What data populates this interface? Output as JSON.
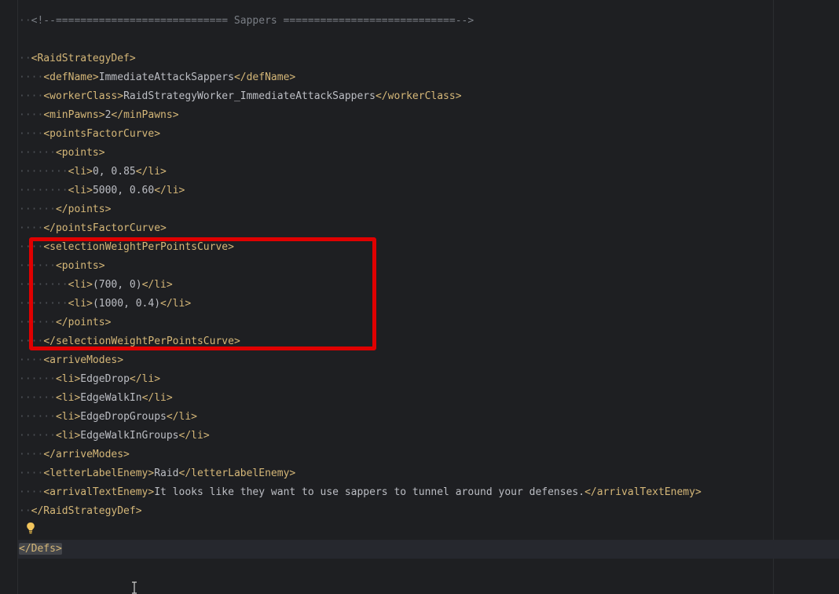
{
  "editor": {
    "lines": [
      {
        "indent": 1,
        "segments": [
          {
            "t": "c",
            "v": "<!--============================ Sappers ============================-->"
          }
        ]
      },
      {
        "indent": 0,
        "segments": []
      },
      {
        "indent": 1,
        "segments": [
          {
            "t": "g",
            "v": "<RaidStrategyDef>"
          }
        ]
      },
      {
        "indent": 2,
        "segments": [
          {
            "t": "g",
            "v": "<defName>"
          },
          {
            "t": "x",
            "v": "ImmediateAttackSappers"
          },
          {
            "t": "g",
            "v": "</defName>"
          }
        ]
      },
      {
        "indent": 2,
        "segments": [
          {
            "t": "g",
            "v": "<workerClass>"
          },
          {
            "t": "x",
            "v": "RaidStrategyWorker_ImmediateAttackSappers"
          },
          {
            "t": "g",
            "v": "</workerClass>"
          }
        ]
      },
      {
        "indent": 2,
        "segments": [
          {
            "t": "g",
            "v": "<minPawns>"
          },
          {
            "t": "x",
            "v": "2"
          },
          {
            "t": "g",
            "v": "</minPawns>"
          }
        ]
      },
      {
        "indent": 2,
        "segments": [
          {
            "t": "g",
            "v": "<pointsFactorCurve>"
          }
        ]
      },
      {
        "indent": 3,
        "segments": [
          {
            "t": "g",
            "v": "<points>"
          }
        ]
      },
      {
        "indent": 4,
        "segments": [
          {
            "t": "g",
            "v": "<li>"
          },
          {
            "t": "x",
            "v": "0, 0.85"
          },
          {
            "t": "g",
            "v": "</li>"
          }
        ]
      },
      {
        "indent": 4,
        "segments": [
          {
            "t": "g",
            "v": "<li>"
          },
          {
            "t": "x",
            "v": "5000, 0.60"
          },
          {
            "t": "g",
            "v": "</li>"
          }
        ]
      },
      {
        "indent": 3,
        "segments": [
          {
            "t": "g",
            "v": "</points>"
          }
        ]
      },
      {
        "indent": 2,
        "segments": [
          {
            "t": "g",
            "v": "</pointsFactorCurve>"
          }
        ]
      },
      {
        "indent": 2,
        "segments": [
          {
            "t": "g",
            "v": "<selectionWeightPerPointsCurve>"
          }
        ]
      },
      {
        "indent": 3,
        "segments": [
          {
            "t": "g",
            "v": "<points>"
          }
        ]
      },
      {
        "indent": 4,
        "segments": [
          {
            "t": "g",
            "v": "<li>"
          },
          {
            "t": "x",
            "v": "(700, 0)"
          },
          {
            "t": "g",
            "v": "</li>"
          }
        ]
      },
      {
        "indent": 4,
        "segments": [
          {
            "t": "g",
            "v": "<li>"
          },
          {
            "t": "x",
            "v": "(1000, 0.4)"
          },
          {
            "t": "g",
            "v": "</li>"
          }
        ]
      },
      {
        "indent": 3,
        "segments": [
          {
            "t": "g",
            "v": "</points>"
          }
        ]
      },
      {
        "indent": 2,
        "segments": [
          {
            "t": "g",
            "v": "</selectionWeightPerPointsCurve>"
          }
        ]
      },
      {
        "indent": 2,
        "segments": [
          {
            "t": "g",
            "v": "<arriveModes>"
          }
        ]
      },
      {
        "indent": 3,
        "segments": [
          {
            "t": "g",
            "v": "<li>"
          },
          {
            "t": "x",
            "v": "EdgeDrop"
          },
          {
            "t": "g",
            "v": "</li>"
          }
        ]
      },
      {
        "indent": 3,
        "segments": [
          {
            "t": "g",
            "v": "<li>"
          },
          {
            "t": "x",
            "v": "EdgeWalkIn"
          },
          {
            "t": "g",
            "v": "</li>"
          }
        ]
      },
      {
        "indent": 3,
        "segments": [
          {
            "t": "g",
            "v": "<li>"
          },
          {
            "t": "x",
            "v": "EdgeDropGroups"
          },
          {
            "t": "g",
            "v": "</li>"
          }
        ]
      },
      {
        "indent": 3,
        "segments": [
          {
            "t": "g",
            "v": "<li>"
          },
          {
            "t": "x",
            "v": "EdgeWalkInGroups"
          },
          {
            "t": "g",
            "v": "</li>"
          }
        ]
      },
      {
        "indent": 2,
        "segments": [
          {
            "t": "g",
            "v": "</arriveModes>"
          }
        ]
      },
      {
        "indent": 2,
        "segments": [
          {
            "t": "g",
            "v": "<letterLabelEnemy>"
          },
          {
            "t": "x",
            "v": "Raid"
          },
          {
            "t": "g",
            "v": "</letterLabelEnemy>"
          }
        ]
      },
      {
        "indent": 2,
        "segments": [
          {
            "t": "g",
            "v": "<arrivalTextEnemy>"
          },
          {
            "t": "x",
            "v": "It looks like they want to use sappers to tunnel around your defenses."
          },
          {
            "t": "g",
            "v": "</arrivalTextEnemy>"
          }
        ]
      },
      {
        "indent": 1,
        "segments": [
          {
            "t": "g",
            "v": "</RaidStrategyDef>"
          }
        ]
      },
      {
        "indent": 0,
        "segments": []
      },
      {
        "indent": 0,
        "segments": [
          {
            "t": "m",
            "v": "</Defs>"
          }
        ]
      }
    ],
    "icons": {
      "bulb": "lightbulb-icon",
      "cursor": "text-cursor-icon"
    },
    "colors": {
      "background": "#1e1f22",
      "tag": "#d5b778",
      "text": "#bcbec4",
      "comment": "#7a7e85",
      "whitespace": "#4e5157",
      "annotation": "#e00000",
      "bulb": "#f2c55c"
    }
  }
}
